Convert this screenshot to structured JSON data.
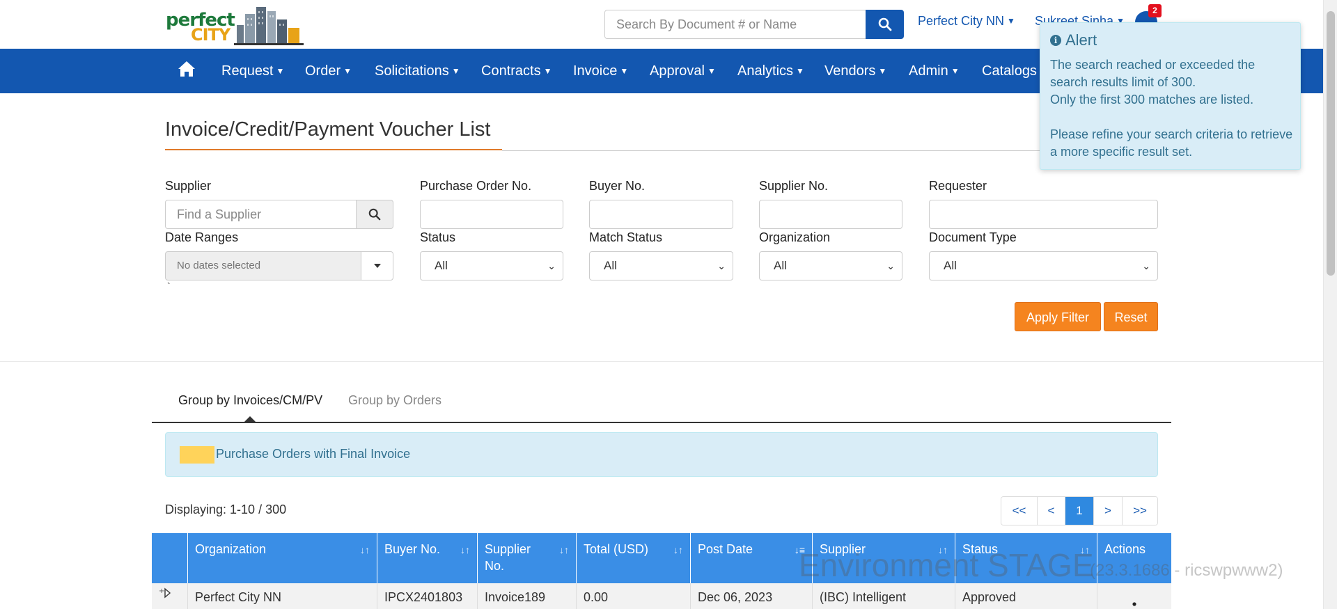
{
  "brand": {
    "logo_line1": "perfect",
    "logo_line2": "CITY"
  },
  "header": {
    "search_placeholder": "Search By Document # or Name",
    "org_dropdown": "Perfect City NN",
    "user_dropdown": "Sukreet Sinha",
    "notification_count": "2"
  },
  "nav": {
    "items": [
      "Request",
      "Order",
      "Solicitations",
      "Contracts",
      "Invoice",
      "Approval",
      "Analytics",
      "Vendors",
      "Admin",
      "Catalogs"
    ]
  },
  "page": {
    "title": "Invoice/Credit/Payment Voucher List"
  },
  "filters": {
    "supplier_label": "Supplier",
    "supplier_placeholder": "Find a Supplier",
    "po_label": "Purchase Order No.",
    "buyer_label": "Buyer No.",
    "supplier_no_label": "Supplier No.",
    "requester_label": "Requester",
    "date_label": "Date Ranges",
    "date_value": "No dates selected",
    "status_label": "Status",
    "status_value": "All",
    "match_label": "Match Status",
    "match_value": "All",
    "org_label": "Organization",
    "org_value": "All",
    "doctype_label": "Document Type",
    "doctype_value": "All",
    "tick": "`",
    "apply_label": "Apply Filter",
    "reset_label": "Reset"
  },
  "tabs": {
    "invoices": "Group by Invoices/CM/PV",
    "orders": "Group by Orders"
  },
  "legend": {
    "text": "Purchase Orders with Final Invoice",
    "swatch_color": "#ffd35a"
  },
  "list": {
    "displaying": "Displaying: 1-10 / 300",
    "pager": [
      "<<",
      "<",
      "1",
      ">",
      ">>"
    ],
    "columns": [
      "Organization",
      "Buyer No.",
      "Supplier No.",
      "Total (USD)",
      "Post Date",
      "Supplier",
      "Status",
      "Actions"
    ],
    "rows": [
      {
        "organization": "Perfect City NN",
        "buyer_no": "IPCX2401803",
        "supplier_no": "Invoice189",
        "total": "0.00",
        "post_date": "Dec 06, 2023",
        "supplier": "(IBC) Intelligent",
        "status": "Approved"
      }
    ]
  },
  "watermark": {
    "env": "Environment STAGE",
    "build": "(23.3.1686 - ricswpwww2)"
  },
  "alert": {
    "title": "Alert",
    "line1": "The search reached or exceeded the search results limit of 300.",
    "line2": "Only the first 300 matches are listed.",
    "line3": "Please refine your search criteria to retrieve a more specific result set."
  },
  "colors": {
    "primary": "#1357b0",
    "header_blue": "#3a8ee6",
    "accent_orange": "#f5841f",
    "alert_bg": "#d9edf7"
  }
}
